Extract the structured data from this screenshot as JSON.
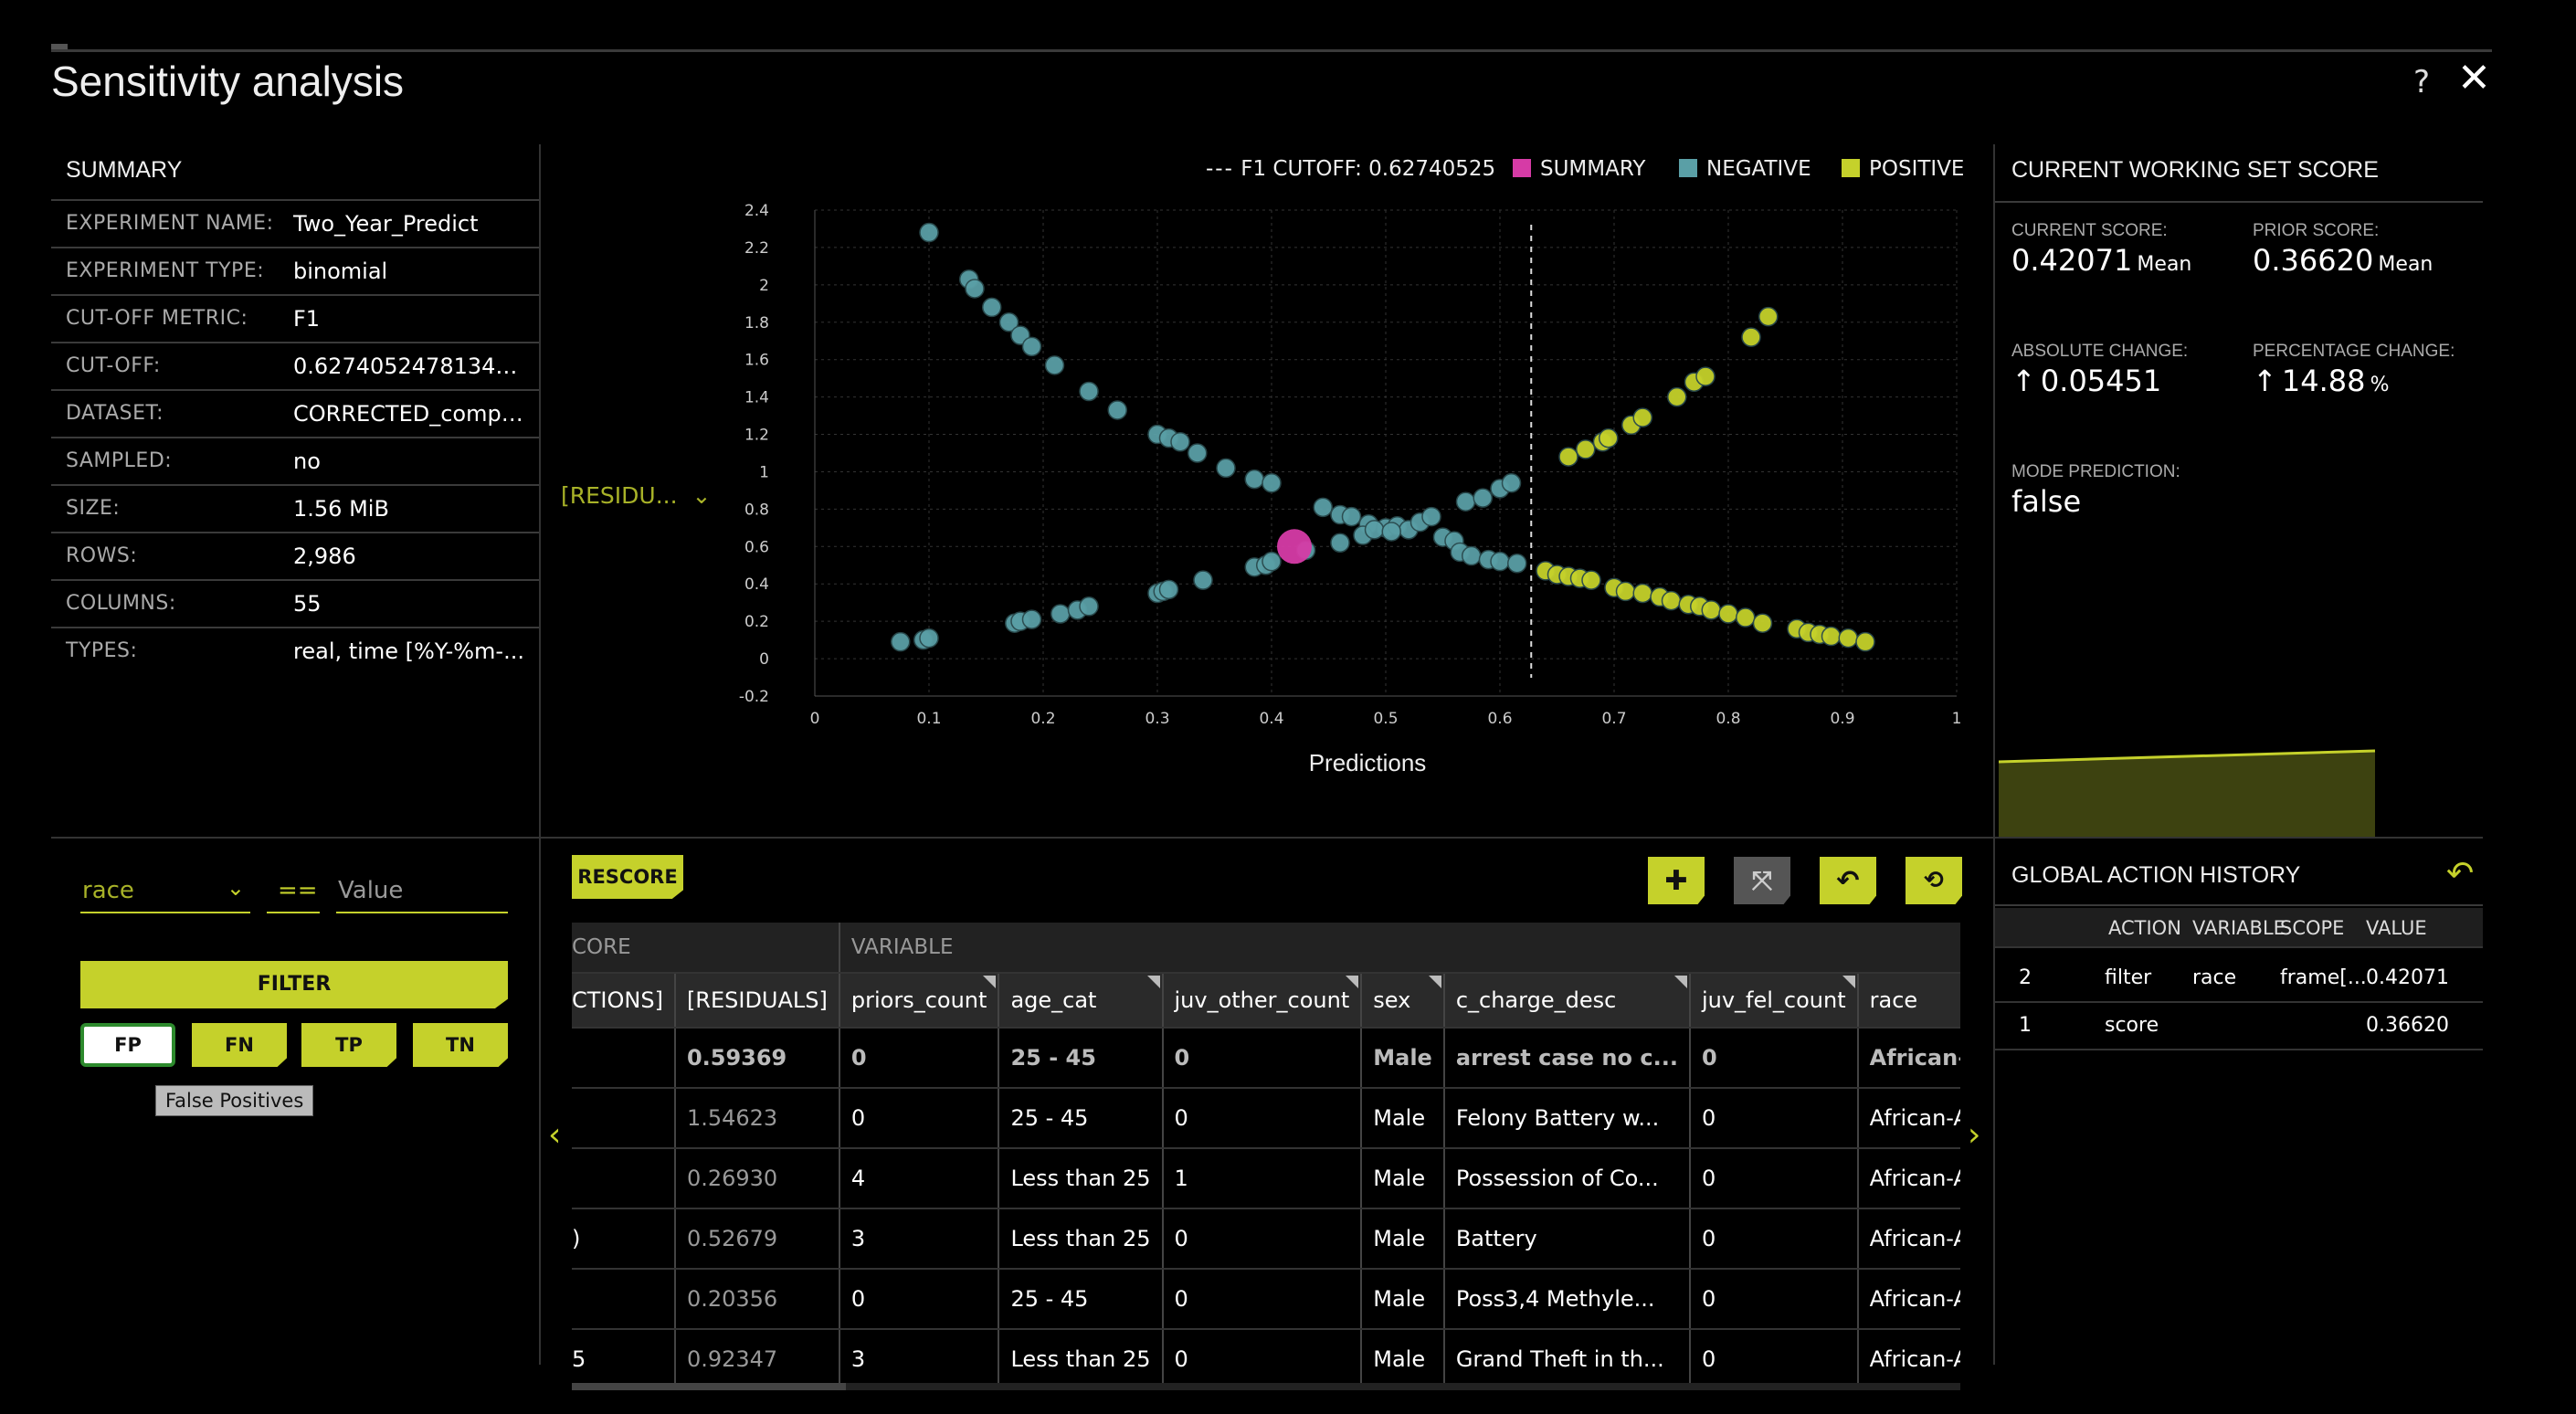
{
  "window": {
    "title": "Sensitivity analysis",
    "help": "?",
    "close": "✕"
  },
  "summary": {
    "title": "SUMMARY",
    "rows": [
      {
        "key": "EXPERIMENT NAME:",
        "value": "Two_Year_Predict"
      },
      {
        "key": "EXPERIMENT TYPE:",
        "value": "binomial"
      },
      {
        "key": "CUT-OFF METRIC:",
        "value": "F1"
      },
      {
        "key": "CUT-OFF:",
        "value": "0.6274052478134111"
      },
      {
        "key": "DATASET:",
        "value": "CORRECTED_compa..."
      },
      {
        "key": "SAMPLED:",
        "value": "no"
      },
      {
        "key": "SIZE:",
        "value": "1.56 MiB"
      },
      {
        "key": "ROWS:",
        "value": "2,986"
      },
      {
        "key": "COLUMNS:",
        "value": "55"
      },
      {
        "key": "TYPES:",
        "value": "real, time [%Y-%m-..."
      }
    ]
  },
  "chart": {
    "y_selector": "[RESIDU...",
    "legend": {
      "cutoff": "F1 CUTOFF: 0.62740525",
      "summary": "SUMMARY",
      "negative": "NEGATIVE",
      "positive": "POSITIVE"
    },
    "colors": {
      "summary": "#d63ba6",
      "negative": "#5a9fa6",
      "positive": "#c5d12b"
    }
  },
  "chart_data": {
    "type": "scatter",
    "xlabel": "Predictions",
    "ylabel": "",
    "xlim": [
      0,
      1
    ],
    "ylim": [
      -0.2,
      2.4
    ],
    "x_ticks": [
      "0",
      "0.1",
      "0.2",
      "0.3",
      "0.4",
      "0.5",
      "0.6",
      "0.7",
      "0.8",
      "0.9",
      "1"
    ],
    "y_ticks": [
      "2.4",
      "2.2",
      "2",
      "1.8",
      "1.6",
      "1.4",
      "1.2",
      "1",
      "0.8",
      "0.6",
      "0.4",
      "0.2",
      "0",
      "-0.2"
    ],
    "cutoff": 0.6274,
    "grid": true,
    "legend_position": "top-right",
    "series": [
      {
        "name": "NEGATIVE",
        "points": [
          [
            0.1,
            2.28
          ],
          [
            0.135,
            2.03
          ],
          [
            0.14,
            1.98
          ],
          [
            0.155,
            1.88
          ],
          [
            0.17,
            1.8
          ],
          [
            0.18,
            1.73
          ],
          [
            0.19,
            1.67
          ],
          [
            0.21,
            1.57
          ],
          [
            0.24,
            1.43
          ],
          [
            0.265,
            1.33
          ],
          [
            0.3,
            1.2
          ],
          [
            0.31,
            1.18
          ],
          [
            0.32,
            1.16
          ],
          [
            0.335,
            1.1
          ],
          [
            0.36,
            1.02
          ],
          [
            0.385,
            0.96
          ],
          [
            0.4,
            0.94
          ],
          [
            0.445,
            0.81
          ],
          [
            0.46,
            0.77
          ],
          [
            0.47,
            0.76
          ],
          [
            0.485,
            0.72
          ],
          [
            0.5,
            0.7
          ],
          [
            0.51,
            0.71
          ],
          [
            0.52,
            0.69
          ],
          [
            0.53,
            0.73
          ],
          [
            0.54,
            0.76
          ],
          [
            0.55,
            0.65
          ],
          [
            0.56,
            0.63
          ],
          [
            0.565,
            0.57
          ],
          [
            0.575,
            0.55
          ],
          [
            0.59,
            0.53
          ],
          [
            0.6,
            0.52
          ],
          [
            0.615,
            0.51
          ],
          [
            0.57,
            0.84
          ],
          [
            0.585,
            0.86
          ],
          [
            0.6,
            0.91
          ],
          [
            0.61,
            0.94
          ],
          [
            0.075,
            0.09
          ],
          [
            0.095,
            0.1
          ],
          [
            0.1,
            0.11
          ],
          [
            0.175,
            0.19
          ],
          [
            0.18,
            0.2
          ],
          [
            0.19,
            0.21
          ],
          [
            0.215,
            0.24
          ],
          [
            0.23,
            0.26
          ],
          [
            0.24,
            0.28
          ],
          [
            0.3,
            0.35
          ],
          [
            0.305,
            0.36
          ],
          [
            0.31,
            0.37
          ],
          [
            0.34,
            0.42
          ],
          [
            0.385,
            0.49
          ],
          [
            0.395,
            0.5
          ],
          [
            0.4,
            0.52
          ],
          [
            0.43,
            0.58
          ],
          [
            0.46,
            0.62
          ],
          [
            0.48,
            0.66
          ],
          [
            0.49,
            0.69
          ],
          [
            0.505,
            0.68
          ]
        ]
      },
      {
        "name": "POSITIVE",
        "points": [
          [
            0.64,
            0.47
          ],
          [
            0.65,
            0.45
          ],
          [
            0.66,
            0.44
          ],
          [
            0.67,
            0.43
          ],
          [
            0.68,
            0.42
          ],
          [
            0.7,
            0.38
          ],
          [
            0.71,
            0.36
          ],
          [
            0.725,
            0.35
          ],
          [
            0.74,
            0.33
          ],
          [
            0.75,
            0.31
          ],
          [
            0.765,
            0.29
          ],
          [
            0.775,
            0.28
          ],
          [
            0.785,
            0.26
          ],
          [
            0.8,
            0.24
          ],
          [
            0.815,
            0.22
          ],
          [
            0.83,
            0.19
          ],
          [
            0.86,
            0.16
          ],
          [
            0.87,
            0.14
          ],
          [
            0.88,
            0.13
          ],
          [
            0.89,
            0.12
          ],
          [
            0.905,
            0.11
          ],
          [
            0.92,
            0.09
          ],
          [
            0.66,
            1.08
          ],
          [
            0.675,
            1.12
          ],
          [
            0.69,
            1.16
          ],
          [
            0.695,
            1.18
          ],
          [
            0.715,
            1.25
          ],
          [
            0.725,
            1.29
          ],
          [
            0.755,
            1.4
          ],
          [
            0.77,
            1.48
          ],
          [
            0.78,
            1.51
          ],
          [
            0.82,
            1.72
          ],
          [
            0.835,
            1.83
          ]
        ]
      },
      {
        "name": "SUMMARY",
        "points": [
          [
            0.42,
            0.6
          ]
        ]
      }
    ]
  },
  "filter": {
    "column": "race",
    "operator": "==",
    "value_placeholder": "Value",
    "button": "FILTER",
    "tags": [
      "FP",
      "FN",
      "TP",
      "TN"
    ],
    "tooltip": "False Positives"
  },
  "table": {
    "rescore": "RESCORE",
    "group_left": "CORE",
    "group_right": "VARIABLE",
    "columns": [
      "CTIONS]",
      "[RESIDUALS]",
      "priors_count",
      "age_cat",
      "juv_other_count",
      "sex",
      "c_charge_desc",
      "juv_fel_count",
      "race"
    ],
    "rows": [
      [
        "",
        "0.59369",
        "0",
        "25 - 45",
        "0",
        "Male",
        "arrest case no c...",
        "0",
        "African-American"
      ],
      [
        "",
        "1.54623",
        "0",
        "25 - 45",
        "0",
        "Male",
        "Felony Battery w...",
        "0",
        "African-American"
      ],
      [
        "",
        "0.26930",
        "4",
        "Less than 25",
        "1",
        "Male",
        "Possession of Co...",
        "0",
        "African-American"
      ],
      [
        ")",
        "0.52679",
        "3",
        "Less than 25",
        "0",
        "Male",
        "Battery",
        "0",
        "African-American"
      ],
      [
        "",
        "0.20356",
        "0",
        "25 - 45",
        "0",
        "Male",
        "Poss3,4 Methyle...",
        "0",
        "African-American"
      ],
      [
        "5",
        "0.92347",
        "3",
        "Less than 25",
        "0",
        "Male",
        "Grand Theft in th...",
        "0",
        "African-American"
      ]
    ],
    "nav_left": "‹",
    "nav_right": "›"
  },
  "score": {
    "title": "CURRENT WORKING SET SCORE",
    "current_label": "CURRENT SCORE:",
    "current_value": "0.42071",
    "current_unit": "Mean",
    "prior_label": "PRIOR SCORE:",
    "prior_value": "0.36620",
    "prior_unit": "Mean",
    "abs_label": "ABSOLUTE CHANGE:",
    "abs_value": "0.05451",
    "pct_label": "PERCENTAGE CHANGE:",
    "pct_value": "14.88",
    "pct_unit": "%",
    "mode_label": "MODE PREDICTION:",
    "mode_value": "false"
  },
  "history": {
    "title": "GLOBAL ACTION HISTORY",
    "headers": [
      "",
      "ACTION",
      "VARIABLE",
      "SCOPE",
      "VALUE"
    ],
    "rows": [
      [
        "2",
        "filter",
        "race",
        "frame[...",
        "0.42071"
      ],
      [
        "1",
        "score",
        "",
        "",
        "0.36620"
      ]
    ]
  }
}
